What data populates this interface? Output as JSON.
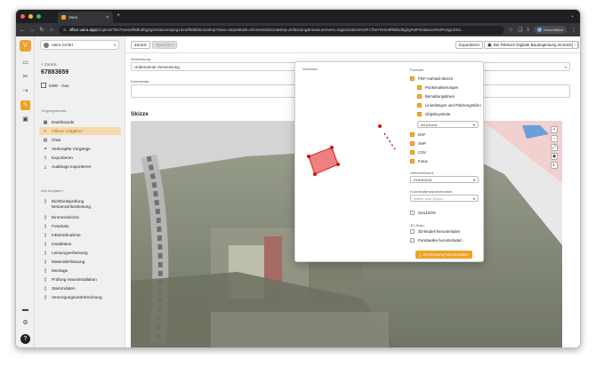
{
  "browser": {
    "tab_title": "Vaira",
    "url_host": "office.vaira.app",
    "url_rest": "/projects/7be7mnm6f9dtnd0g2g/instances/pzg14m2f9d0b0iomahnp?view=steps&task=Einmessskizze&step=Erfassung&measurement=organizations%2Fc7be7mnm6f9dtnd0g2g%2Finstances%2Fozg14m2...",
    "profile_label": "Geschäftlich",
    "colors": {
      "close": "#ff5f57",
      "minimize": "#febc2e",
      "maximize": "#28c840"
    }
  },
  "rail": {
    "icons": [
      "folder-icon",
      "tools-icon",
      "workflow-icon",
      "tasks-icon",
      "contacts-icon",
      "storage-icon",
      "settings-icon",
      "help-icon"
    ]
  },
  "sidebar": {
    "org_name": "Vaira GmbH",
    "back_label": "< Zurück",
    "project_number": "67883659",
    "project_sub": "EWE - Gas",
    "section_process": "Vorgangsdetails",
    "process_items": [
      {
        "label": "Dashboards",
        "icon": "grid-icon"
      },
      {
        "label": "Offene Aufgaben",
        "icon": "check-icon"
      },
      {
        "label": "Chat",
        "icon": "chat-icon"
      },
      {
        "label": "Verknüpfte Vorgänge",
        "icon": "link-icon"
      },
      {
        "label": "Exportieren",
        "icon": "export-icon"
      },
      {
        "label": "Audittogs exportieren",
        "icon": "download-icon"
      }
    ],
    "section_tasks": "Alle Aufgaben",
    "task_items": [
      "Dichtheitsprüfung Netzanschlussleitung",
      "Einmessskizze",
      "Fotodoku",
      "Inbetriebnahme",
      "Installation",
      "Leistungserfassung",
      "Materialerfassung",
      "Montage",
      "Prüfung Hausinstallation",
      "Stammdaten",
      "Versorgungsunterbrechung"
    ]
  },
  "toolbar": {
    "back_button": "Zurück",
    "save_button": "Speichern",
    "export_button": "Exportieren",
    "submit_button": "Bei Telekom Digitale Baubegleitung einreichen",
    "more_icon": "⋮"
  },
  "form": {
    "measurement_label": "Vermessung",
    "measurement_value": "Unbenannte Vermessung",
    "comment_label": "Kommentar"
  },
  "sketch": {
    "title": "Skizze",
    "tools": [
      "zoom-in-icon",
      "zoom-out-icon",
      "fit-icon",
      "eye-icon",
      "layers-icon"
    ]
  },
  "export_popover": {
    "preview_label": "Vorschau",
    "formats_label": "Formate",
    "pdf_label": "PDF-Aufmaß-Skizze",
    "pdf_suboptions": [
      {
        "label": "Punktmarkierungen",
        "checked": true
      },
      {
        "label": "Bemaßungslinien",
        "checked": true
      },
      {
        "label": "Linienlängen und Flächengrößen",
        "checked": true
      },
      {
        "label": "Objektsymbole",
        "checked": true
      }
    ],
    "paper_size": "A4 (Hoch)",
    "formats": [
      {
        "label": "DXF",
        "checked": true
      },
      {
        "label": "SHP",
        "checked": true
      },
      {
        "label": "CSV",
        "checked": true
      },
      {
        "label": "Fotos",
        "checked": true
      }
    ],
    "height_ref_label": "Höhenreferenz",
    "height_ref_value": "DHHN2016",
    "coord_label": "Koordinatentransformation",
    "coord_placeholder": "Wähle eine Option...",
    "geojson_label": "GeoJSON",
    "scan_label": "3D-Scan",
    "scan_options": [
      {
        "label": "3D-Modell herunterladen",
        "checked": false
      },
      {
        "label": "Punktwolke herunterladen",
        "checked": false
      }
    ],
    "download_button": "Vermessung herunterladen",
    "accent": "#f0a020"
  }
}
